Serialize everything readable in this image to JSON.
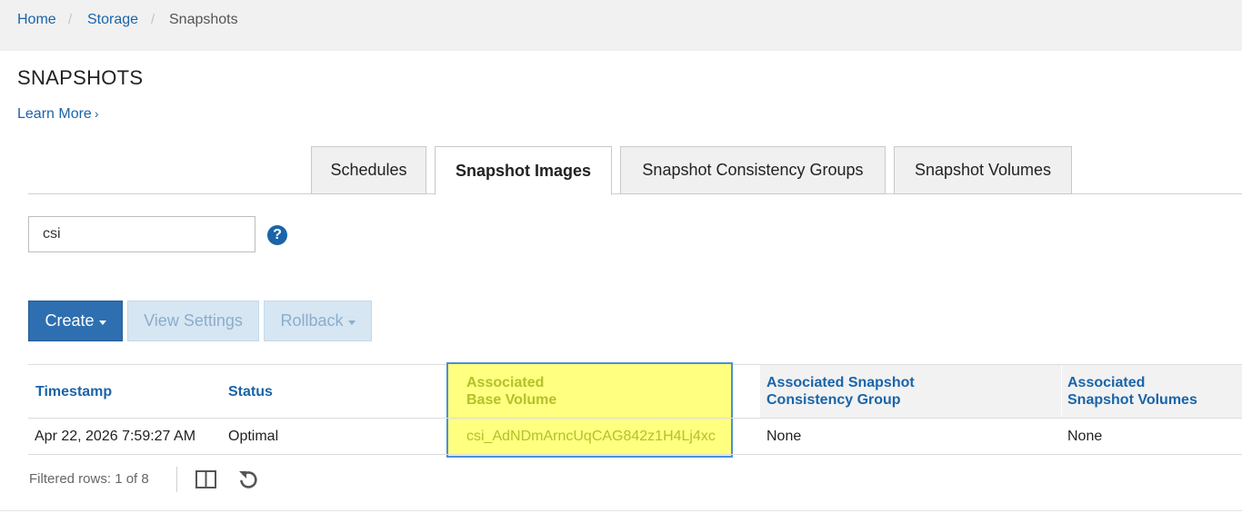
{
  "breadcrumb": {
    "items": [
      "Home",
      "Storage",
      "Snapshots"
    ],
    "separator": "/"
  },
  "page": {
    "title": "SNAPSHOTS",
    "learn_more": "Learn More",
    "learn_more_chevron": "›"
  },
  "tabs": [
    {
      "label": "Schedules",
      "active": false
    },
    {
      "label": "Snapshot Images",
      "active": true
    },
    {
      "label": "Snapshot Consistency Groups",
      "active": false
    },
    {
      "label": "Snapshot Volumes",
      "active": false
    }
  ],
  "filter": {
    "value": "csi",
    "help_icon": "question-circle-icon",
    "help_glyph": "?"
  },
  "toolbar": {
    "create": "Create",
    "view_settings": "View Settings",
    "rollback": "Rollback"
  },
  "table": {
    "columns": [
      {
        "line1": "Timestamp",
        "line2": ""
      },
      {
        "line1": "Status",
        "line2": ""
      },
      {
        "line1": "Associated",
        "line2": "Base Volume"
      },
      {
        "line1": "Associated Snapshot",
        "line2": "Consistency Group"
      },
      {
        "line1": "Associated",
        "line2": "Snapshot Volumes"
      }
    ],
    "rows": [
      {
        "timestamp": "Apr 22, 2026 7:59:27 AM",
        "status": "Optimal",
        "base_volume": "csi_AdNDmArncUqCAG842z1H4Lj4xc",
        "consistency_group": "None",
        "snapshot_volumes": "None"
      }
    ]
  },
  "footer": {
    "filtered_rows": "Filtered rows: 1 of 8",
    "columns_icon": "columns-icon",
    "refresh_icon": "refresh-icon"
  },
  "colors": {
    "link": "#1a64a9",
    "primary_button": "#2d6fb0",
    "highlight": "#ffff80",
    "highlight_border": "#4a90d9"
  }
}
